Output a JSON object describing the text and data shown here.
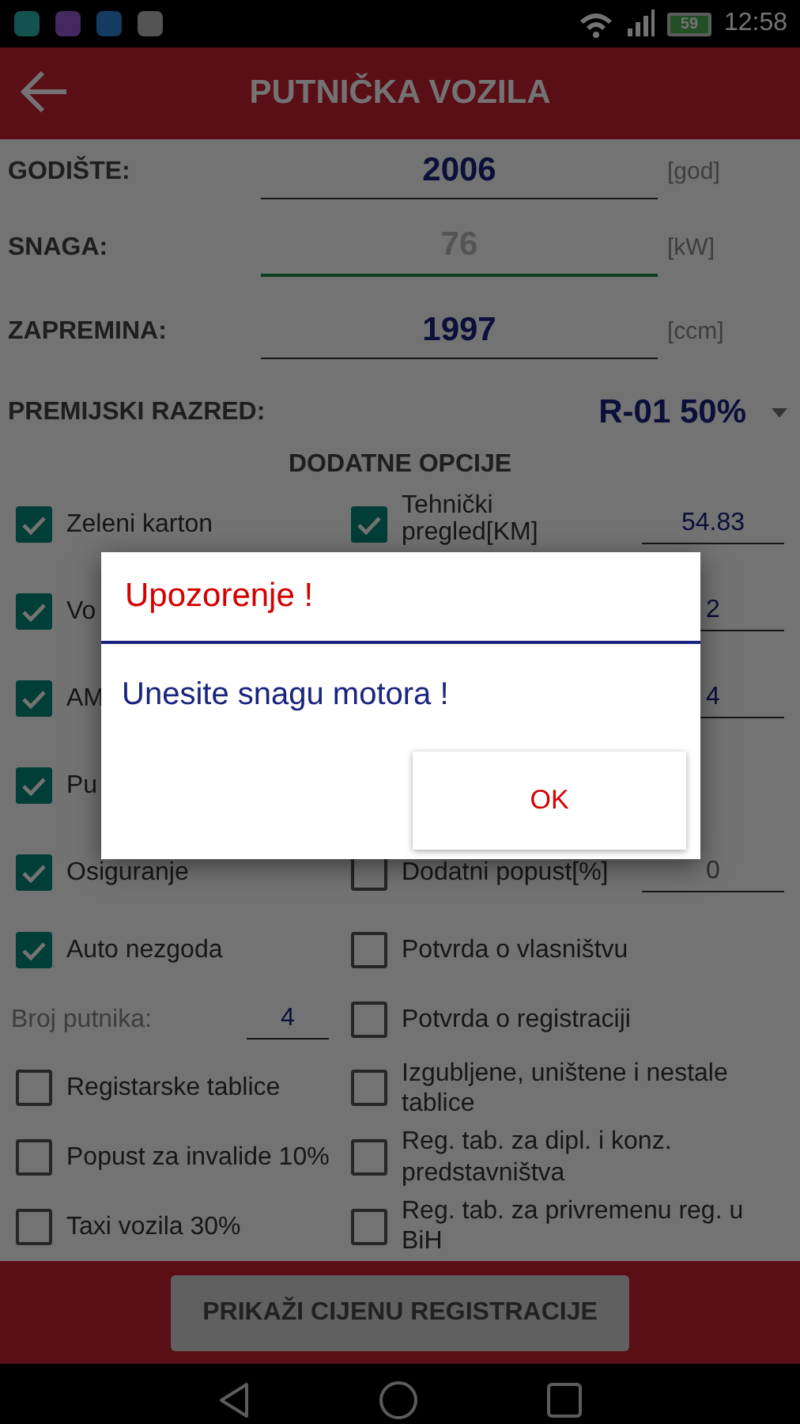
{
  "status_bar": {
    "battery": "59",
    "time": "12:58"
  },
  "header": {
    "title": "PUTNIČKA VOZILA"
  },
  "fields": [
    {
      "label": "GODIŠTE:",
      "value": "2006",
      "unit": "[god]",
      "focused": false
    },
    {
      "label": "SNAGA:",
      "placeholder": "76",
      "unit": "[kW]",
      "focused": true
    },
    {
      "label": "ZAPREMINA:",
      "value": "1997",
      "unit": "[ccm]",
      "focused": false
    }
  ],
  "premium_class": {
    "label": "PREMIJSKI RAZRED:",
    "value": "R-01 50%"
  },
  "section_title": "DODATNE OPCIJE",
  "option_rows": [
    {
      "left": {
        "kind": "checkbox",
        "label": "Zeleni karton",
        "checked": true
      },
      "right": {
        "kind": "checkbox",
        "label": "Tehnički pregled[KM]",
        "checked": true,
        "value": "54.83"
      }
    },
    {
      "left": {
        "kind": "checkbox",
        "label": "Vo",
        "checked": true
      },
      "right": {
        "kind": "value",
        "value": "2"
      }
    },
    {
      "left": {
        "kind": "checkbox",
        "label": "AM",
        "checked": true
      },
      "right": {
        "kind": "value",
        "value": "4"
      }
    },
    {
      "left": {
        "kind": "checkbox",
        "label": "Pu",
        "checked": true
      }
    },
    {
      "left": {
        "kind": "checkbox",
        "label": "Osiguranje",
        "checked": true
      },
      "right": {
        "kind": "checkbox",
        "label": "Dodatni popust[%]",
        "checked": false,
        "placeholder": "0"
      }
    },
    {
      "left": {
        "kind": "checkbox",
        "label": "Auto nezgoda",
        "checked": true
      },
      "right": {
        "kind": "checkbox",
        "label": "Potvrda o vlasništvu",
        "checked": false
      }
    },
    {
      "left": {
        "kind": "number",
        "label": "Broj putnika:",
        "value": "4"
      },
      "right": {
        "kind": "checkbox",
        "label": "Potvrda o registraciji",
        "checked": false
      }
    },
    {
      "left": {
        "kind": "checkbox",
        "label": "Registarske tablice",
        "checked": false
      },
      "right": {
        "kind": "checkbox",
        "label": "Izgubljene, uništene i nestale tablice",
        "checked": false
      }
    },
    {
      "left": {
        "kind": "checkbox",
        "label": "Popust za invalide 10%",
        "checked": false
      },
      "right": {
        "kind": "checkbox",
        "label": "Reg. tab. za dipl. i konz. predstavništva",
        "checked": false
      }
    },
    {
      "left": {
        "kind": "checkbox",
        "label": "Taxi vozila 30%",
        "checked": false
      },
      "right": {
        "kind": "checkbox",
        "label": "Reg. tab. za privremenu reg. u BiH",
        "checked": false
      }
    }
  ],
  "submit_button": {
    "label": "PRIKAŽI CIJENU REGISTRACIJE",
    "disabled": true
  },
  "dialog": {
    "title": "Upozorenje !",
    "message": "Unesite snagu motora !",
    "button": "OK"
  }
}
